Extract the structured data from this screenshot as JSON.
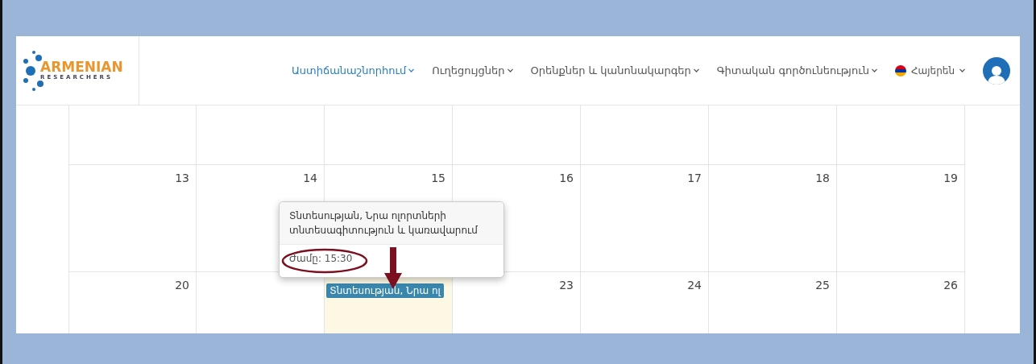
{
  "logo": {
    "title": "ARMENIAN",
    "subtitle": "RESEARCHERS"
  },
  "nav": [
    {
      "label": "Աստիճանաշնորհում",
      "selected": true
    },
    {
      "label": "Ուղեցույցներ",
      "selected": false
    },
    {
      "label": "Օրենքներ և կանոնակարգեր",
      "selected": false
    },
    {
      "label": "Գիտական գործունեություն",
      "selected": false
    }
  ],
  "language": {
    "label": "Հայերեն"
  },
  "calendar": {
    "weeks": [
      [
        {
          "today": false
        },
        {
          "today": false
        },
        {
          "today": false
        },
        {
          "today": false
        },
        {
          "today": false
        },
        {
          "today": false
        },
        {
          "today": false
        }
      ],
      [
        {
          "day": "13",
          "today": false
        },
        {
          "day": "14",
          "today": false
        },
        {
          "day": "15",
          "today": false
        },
        {
          "day": "16",
          "today": false
        },
        {
          "day": "17",
          "today": false
        },
        {
          "day": "18",
          "today": false
        },
        {
          "day": "19",
          "today": false
        }
      ],
      [
        {
          "day": "20",
          "today": false
        },
        {
          "today": false
        },
        {
          "today": true,
          "events": [
            "Տնտեսության, Նրա ոլ"
          ]
        },
        {
          "day": "23",
          "today": false
        },
        {
          "day": "24",
          "today": false
        },
        {
          "day": "25",
          "today": false
        },
        {
          "day": "26",
          "today": false
        }
      ]
    ]
  },
  "popover": {
    "title": "Տնտեսության, Նրա ոլորտների տնտեսագիտություն և կառավարում",
    "time": "Ժամը: 15:30"
  }
}
